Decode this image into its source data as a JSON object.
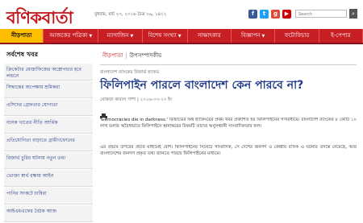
{
  "header": {
    "logo_text": "বণিকবার্তা",
    "date_line": "বুধবার, মার্চ ২৩, ২০১৬ চৈত্র ০৯, ১৪২২",
    "social": [
      {
        "name": "facebook",
        "glyph": "f",
        "color": "#3b5998"
      },
      {
        "name": "twitter",
        "glyph": "t",
        "color": "#1da1f2"
      },
      {
        "name": "google-plus",
        "glyph": "g",
        "color": "#dd4b39"
      },
      {
        "name": "youtube",
        "glyph": "▶",
        "color": "#cc0000"
      }
    ],
    "search_placeholder": "Search"
  },
  "nav": [
    {
      "label": "নীড়পাতা",
      "active": true
    },
    {
      "label": "আজকের পত্রিকা",
      "dropdown": true
    },
    {
      "label": "ম্যাগাজিন",
      "dropdown": true
    },
    {
      "label": "বিশেষ সংখ্যা",
      "dropdown": true
    },
    {
      "label": "সাক্ষাৎকার"
    },
    {
      "label": "বিজ্ঞাপন",
      "dropdown": true
    },
    {
      "label": "ফটোফিচার"
    },
    {
      "label": "ই-পেপার"
    }
  ],
  "sidebar": {
    "title": "সর্বশেষ খবর",
    "items": [
      "ক্রিকেটার মোস্তাফিজের অস্ত্রোপচার হবে লন্ডনে",
      "সিদ্ধান্তের অপেক্ষায় শ্রমিকরা",
      "এসিদের গ্রেফতার যোগ্যতা",
      "ব্যাংক খাতের নীতি আর্থিক",
      "প্রতিযোগিতা বাড়াতে গ্রামীণফোনের",
      "রিজার্ভ চুরির ঘটনায় নতুন তথ্য",
      "ভোক্তা স্বার্থ রক্ষায় আইন",
      "পানির সংকটে চাষিরা",
      "আইএমএফের বৈঠক আজ"
    ]
  },
  "breadcrumb": {
    "home": "নীড়পাতা",
    "section": "উপসম্পাদকীয়"
  },
  "article": {
    "kicker": "বাংলাদেশ ব্যাংকের রিজার্ভ হ্যাকড",
    "headline": "ফিলিপাইন পারলে বাংলাদেশ কেন পারবে না?",
    "byline": "মোস্তফা কামাল পাশা | ২০১৬-০৩-২৩ ইং",
    "paragraphs": [
      "'Democracies die in darkness.' রিজার্ভের অর্থ হ্যাকিংয়ের প্রথম খবর প্রকাশিত হয় ফিলিপাইনের গণমাধ্যমে। বাংলাদেশ ব্যাংকের ৮ কোটি ১০ লাখ ডলার অবৈধভাবে ফিলিপাইনে স্থানান্তরের বিষয়টি তাদের অনুসন্ধানী সাংবাদিকতার ফল।",
      "এর প্রভাব উপরের প্রচার মাধ্যমেই বেশি। ফিলিপাইনের সিনেটে সাংবাদিক, সে দেশের জনগণ ও কেন্দ্রীয় ব্যাংক এ ঘটনার তদন্তে নেমেছে, আর বাংলাদেশের জনগণ প্রকৃত তথ্য জানতে পারছে ফিলিপাইনের মাধ্যমে।"
    ]
  }
}
